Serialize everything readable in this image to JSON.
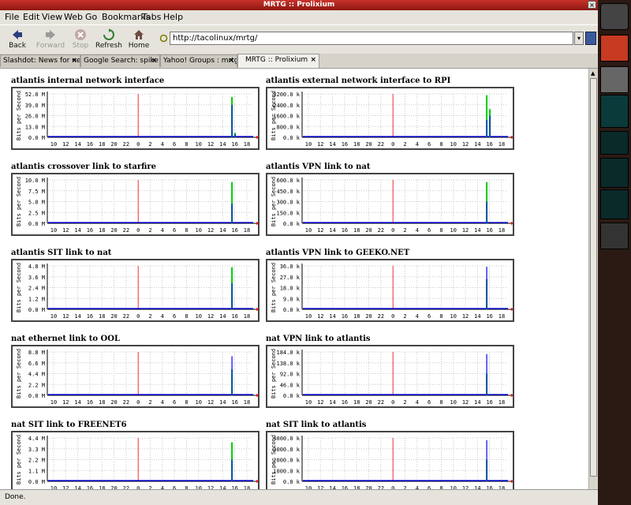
{
  "window": {
    "title": "MRTG :: Prolixium"
  },
  "menu": [
    {
      "label": "File"
    },
    {
      "label": "Edit"
    },
    {
      "label": "View"
    },
    {
      "label": "Web"
    },
    {
      "label": "Go"
    },
    {
      "label": "Bookmarks"
    },
    {
      "label": "Tabs"
    },
    {
      "label": "Help"
    }
  ],
  "toolbar": {
    "back": "Back",
    "forward": "Forward",
    "stop": "Stop",
    "refresh": "Refresh",
    "home": "Home",
    "url": "http://tacolinux/mrtg/"
  },
  "tabs": [
    {
      "label": "Slashdot: News for ne"
    },
    {
      "label": "Google Search: spike"
    },
    {
      "label": "Yahoo! Groups : mrtg"
    },
    {
      "label": "MRTG :: Prolixium"
    }
  ],
  "axis": {
    "ylabel": "Bits per Second",
    "xticks": [
      "10",
      "12",
      "14",
      "16",
      "18",
      "20",
      "22",
      "0",
      "2",
      "4",
      "6",
      "8",
      "10",
      "12",
      "14",
      "16",
      "18"
    ]
  },
  "graphs": [
    {
      "title": "atlantis internal network interface",
      "yticks": [
        "52.0 M",
        "39.0 M",
        "26.0 M",
        "13.0 M",
        "0.0 M"
      ],
      "spike": [
        {
          "green": 0.93,
          "blue": 0.75
        },
        {
          "green": 0.1,
          "blue": 0.08
        }
      ]
    },
    {
      "title": "atlantis external network interface to RPI",
      "yticks": [
        "3200.0 k",
        "2400.0 k",
        "1600.0 k",
        "800.0 k",
        "0.0 k"
      ],
      "spike": [
        {
          "green": 0.97,
          "blue": 0.4
        },
        {
          "green": 0.65,
          "blue": 0.5
        }
      ]
    },
    {
      "title": "atlantis crossover link to starfire",
      "yticks": [
        "10.0 M",
        "7.5 M",
        "5.0 M",
        "2.5 M",
        "0.0 M"
      ],
      "spike": [
        {
          "green": 0.95,
          "blue": 0.45
        },
        {
          "green": 0,
          "blue": 0
        }
      ]
    },
    {
      "title": "atlantis VPN link to nat",
      "yticks": [
        "600.0 k",
        "450.0 k",
        "300.0 k",
        "150.0 k",
        "0.0 k"
      ],
      "spike": [
        {
          "green": 0.95,
          "blue": 0.5
        },
        {
          "green": 0,
          "blue": 0
        }
      ]
    },
    {
      "title": "atlantis SIT link to nat",
      "yticks": [
        "4.8 M",
        "3.6 M",
        "2.4 M",
        "1.2 M",
        "0.0 M"
      ],
      "spike": [
        {
          "green": 0.97,
          "blue": 0.6
        },
        {
          "green": 0,
          "blue": 0
        }
      ]
    },
    {
      "title": "atlantis VPN link to GEEKO.NET",
      "yticks": [
        "36.0 k",
        "27.0 k",
        "18.0 k",
        "9.0 k",
        "0.0 k"
      ],
      "spike": [
        {
          "green": 0.7,
          "blue": 0.98
        },
        {
          "green": 0,
          "blue": 0
        }
      ]
    },
    {
      "title": "nat ethernet link to OOL",
      "yticks": [
        "8.8 M",
        "6.6 M",
        "4.4 M",
        "2.2 M",
        "0.0 M"
      ],
      "spike": [
        {
          "green": 0.6,
          "blue": 0.9
        },
        {
          "green": 0,
          "blue": 0
        }
      ]
    },
    {
      "title": "nat VPN link to atlantis",
      "yticks": [
        "184.0 k",
        "138.0 k",
        "92.0 k",
        "46.0 k",
        "0.0 k"
      ],
      "spike": [
        {
          "green": 0.5,
          "blue": 0.95
        },
        {
          "green": 0,
          "blue": 0
        }
      ]
    },
    {
      "title": "nat SIT link to FREENET6",
      "yticks": [
        "4.4 M",
        "3.3 M",
        "2.2 M",
        "1.1 M",
        "0.0 M"
      ],
      "spike": [
        {
          "green": 0.9,
          "blue": 0.5
        },
        {
          "green": 0,
          "blue": 0
        }
      ]
    },
    {
      "title": "nat SIT link to atlantis",
      "yticks": [
        "4000.0 k",
        "3000.0 k",
        "2000.0 k",
        "1000.0 k",
        "0.0 k"
      ],
      "spike": [
        {
          "green": 0.5,
          "blue": 0.95
        },
        {
          "green": 0,
          "blue": 0
        }
      ]
    }
  ],
  "status": "Done.",
  "colors": {
    "in": "#00cc00",
    "out": "#0000ff",
    "grid": "#c8c8c8",
    "now": "#ff0000"
  }
}
